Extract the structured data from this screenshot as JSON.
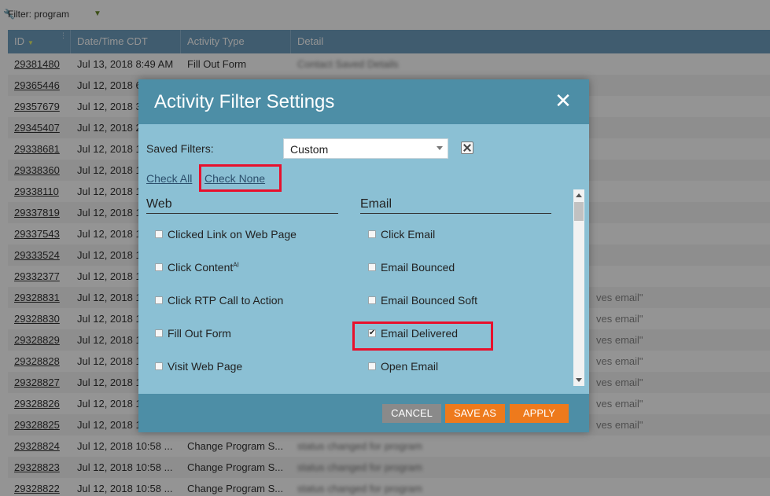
{
  "filter_bar": {
    "label": "Filter: program"
  },
  "table": {
    "headers": {
      "id": "ID",
      "datetime": "Date/Time CDT",
      "activity": "Activity Type",
      "detail": "Detail"
    },
    "rows": [
      {
        "id": "29381480",
        "datetime": "Jul 13, 2018 8:49 AM",
        "activity": "Fill Out Form",
        "detail": "Contact Saved Details"
      },
      {
        "id": "29365446",
        "datetime": "Jul 12, 2018 6",
        "activity": "",
        "detail": ""
      },
      {
        "id": "29357679",
        "datetime": "Jul 12, 2018 3",
        "activity": "",
        "detail": ""
      },
      {
        "id": "29345407",
        "datetime": "Jul 12, 2018 2",
        "activity": "",
        "detail": ""
      },
      {
        "id": "29338681",
        "datetime": "Jul 12, 2018 1",
        "activity": "",
        "detail": ""
      },
      {
        "id": "29338360",
        "datetime": "Jul 12, 2018 1",
        "activity": "",
        "detail": ""
      },
      {
        "id": "29338110",
        "datetime": "Jul 12, 2018 1",
        "activity": "",
        "detail": ""
      },
      {
        "id": "29337819",
        "datetime": "Jul 12, 2018 1",
        "activity": "",
        "detail": ""
      },
      {
        "id": "29337543",
        "datetime": "Jul 12, 2018 1",
        "activity": "",
        "detail": ""
      },
      {
        "id": "29333524",
        "datetime": "Jul 12, 2018 1",
        "activity": "",
        "detail": ""
      },
      {
        "id": "29332377",
        "datetime": "Jul 12, 2018 1",
        "activity": "",
        "detail": ""
      },
      {
        "id": "29328831",
        "datetime": "Jul 12, 2018 1",
        "activity": "",
        "detail": ""
      },
      {
        "id": "29328830",
        "datetime": "Jul 12, 2018 1",
        "activity": "",
        "detail": ""
      },
      {
        "id": "29328829",
        "datetime": "Jul 12, 2018 1",
        "activity": "",
        "detail": ""
      },
      {
        "id": "29328828",
        "datetime": "Jul 12, 2018 1",
        "activity": "",
        "detail": ""
      },
      {
        "id": "29328827",
        "datetime": "Jul 12, 2018 1",
        "activity": "",
        "detail": ""
      },
      {
        "id": "29328826",
        "datetime": "Jul 12, 2018 1",
        "activity": "",
        "detail": ""
      },
      {
        "id": "29328825",
        "datetime": "Jul 12, 2018 1",
        "activity": "",
        "detail": ""
      },
      {
        "id": "29328824",
        "datetime": "Jul 12, 2018 10:58 ...",
        "activity": "Change Program S...",
        "detail": "status changed for program"
      },
      {
        "id": "29328823",
        "datetime": "Jul 12, 2018 10:58 ...",
        "activity": "Change Program S...",
        "detail": "status changed for program"
      },
      {
        "id": "29328822",
        "datetime": "Jul 12, 2018 10:58 ...",
        "activity": "Change Program S...",
        "detail": "status changed for program"
      }
    ],
    "partial_detail_text": "ves email\""
  },
  "modal": {
    "title": "Activity Filter Settings",
    "saved_filters_label": "Saved Filters:",
    "saved_filters_value": "Custom",
    "check_all": "Check All",
    "check_none": "Check None",
    "web_header": "Web",
    "email_header": "Email",
    "web_options": [
      {
        "label": "Clicked Link on Web Page",
        "checked": false
      },
      {
        "label": "Click Content",
        "sup": "AI",
        "checked": false
      },
      {
        "label": "Click RTP Call to Action",
        "checked": false
      },
      {
        "label": "Fill Out Form",
        "checked": false
      },
      {
        "label": "Visit Web Page",
        "checked": false
      }
    ],
    "email_options": [
      {
        "label": "Click Email",
        "checked": false
      },
      {
        "label": "Email Bounced",
        "checked": false
      },
      {
        "label": "Email Bounced Soft",
        "checked": false
      },
      {
        "label": "Email Delivered",
        "checked": true
      },
      {
        "label": "Open Email",
        "checked": false
      }
    ],
    "buttons": {
      "cancel": "CANCEL",
      "save_as": "SAVE AS",
      "apply": "APPLY"
    }
  },
  "colors": {
    "modal_header": "#4d8ea6",
    "modal_body": "#8bc0d4",
    "table_header": "#6f9fbf",
    "accent_orange": "#ee7a1c",
    "highlight_red": "#e8102c"
  }
}
